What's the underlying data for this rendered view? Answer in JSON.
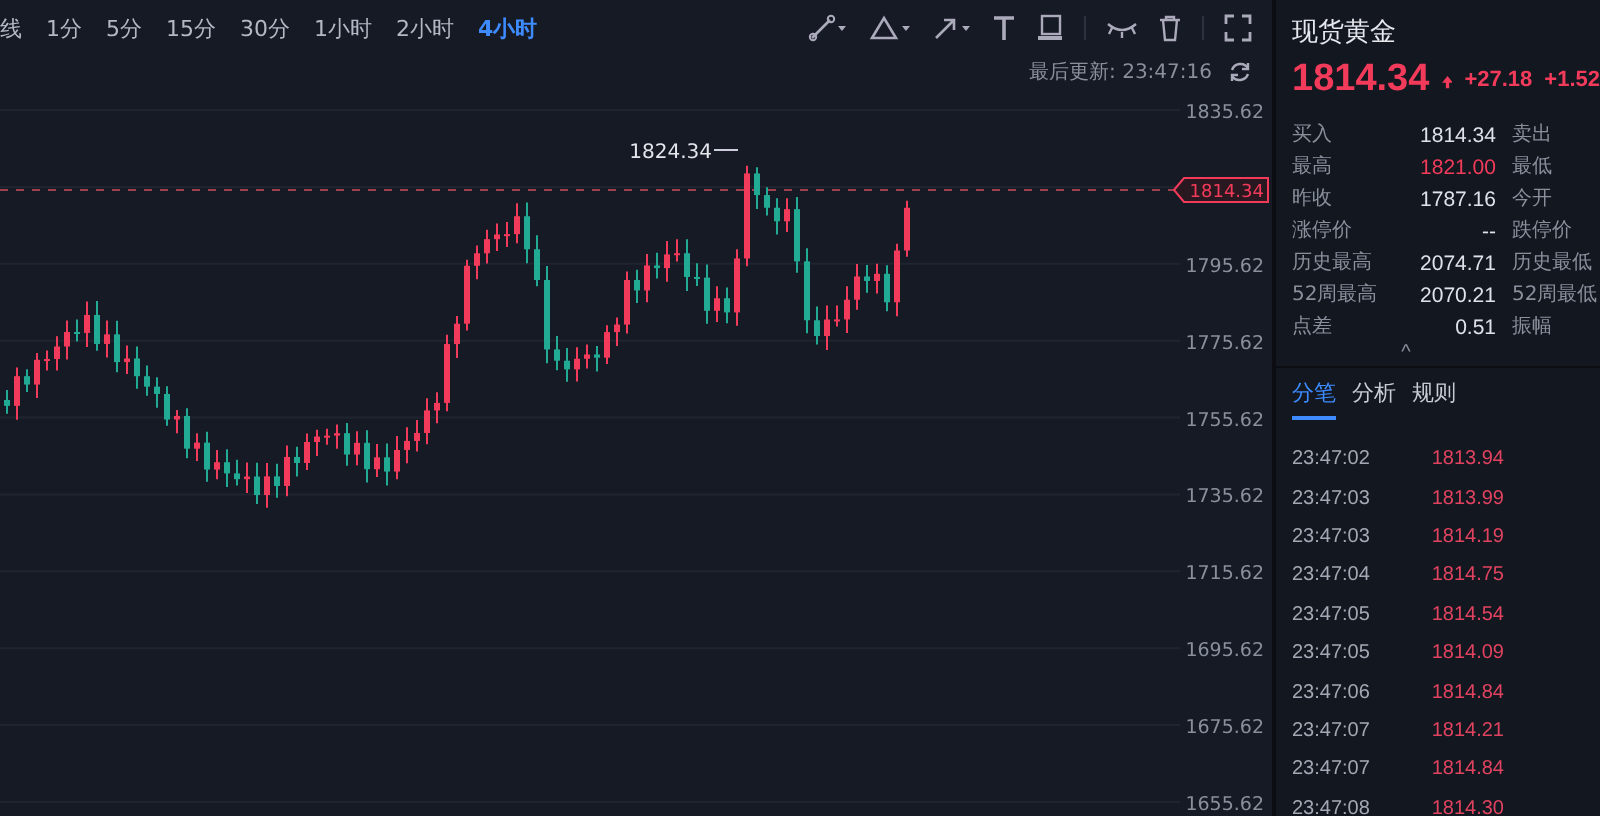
{
  "toolbar": {
    "intervals": [
      {
        "label": "线",
        "selected": false
      },
      {
        "label": "1分",
        "selected": false
      },
      {
        "label": "5分",
        "selected": false
      },
      {
        "label": "15分",
        "selected": false
      },
      {
        "label": "30分",
        "selected": false
      },
      {
        "label": "1小时",
        "selected": false
      },
      {
        "label": "2小时",
        "selected": false
      },
      {
        "label": "4小时",
        "selected": true
      }
    ],
    "last_update": "最后更新: 23:47:16"
  },
  "chart": {
    "y_axis_labels": [
      "1835.62",
      "1795.62",
      "1775.62",
      "1755.62",
      "1735.62",
      "1715.62",
      "1695.62",
      "1675.62",
      "1655.62"
    ],
    "high_label": "1824.34",
    "current_price_tag": "1814.34"
  },
  "quote": {
    "title": "现货黄金",
    "price": "1814.34",
    "rising": true,
    "change": "+27.18",
    "change_percent": "+1.52",
    "stats": [
      {
        "label": "买入",
        "value": "1814.34",
        "value_up": false,
        "label_2": "卖出"
      },
      {
        "label": "最高",
        "value": "1821.00",
        "value_up": true,
        "label_2": "最低"
      },
      {
        "label": "昨收",
        "value": "1787.16",
        "value_up": false,
        "label_2": "今开"
      },
      {
        "label": "涨停价",
        "value": "--",
        "value_up": false,
        "label_2": "跌停价"
      },
      {
        "label": "历史最高",
        "value": "2074.71",
        "value_up": false,
        "label_2": "历史最低"
      },
      {
        "label": "52周最高",
        "value": "2070.21",
        "value_up": false,
        "label_2": "52周最低"
      },
      {
        "label": "点差",
        "value": "0.51",
        "value_up": false,
        "label_2": "振幅"
      }
    ],
    "collapse": "^"
  },
  "tabs": [
    {
      "label": "分笔",
      "selected": true
    },
    {
      "label": "分析",
      "selected": false
    },
    {
      "label": "规则",
      "selected": false
    }
  ],
  "ticks": [
    {
      "time": "23:47:02",
      "price": "1813.94"
    },
    {
      "time": "23:47:03",
      "price": "1813.99"
    },
    {
      "time": "23:47:03",
      "price": "1814.19"
    },
    {
      "time": "23:47:04",
      "price": "1814.75"
    },
    {
      "time": "23:47:05",
      "price": "1814.54"
    },
    {
      "time": "23:47:05",
      "price": "1814.09"
    },
    {
      "time": "23:47:06",
      "price": "1814.84"
    },
    {
      "time": "23:47:07",
      "price": "1814.21"
    },
    {
      "time": "23:47:07",
      "price": "1814.84"
    },
    {
      "time": "23:47:08",
      "price": "1814.30"
    }
  ]
}
